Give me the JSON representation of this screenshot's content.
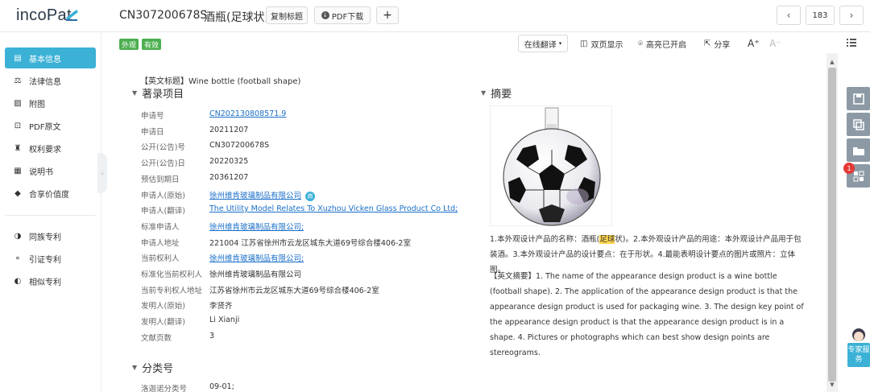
{
  "app": {
    "logo_text": "incoPat",
    "patent_no": "CN307200678S",
    "patent_name": "酒瓶(足球状)",
    "copy_title_label": "复制标题",
    "pdf_download_label": "PDF下载",
    "add_label": "+",
    "page_number": "183"
  },
  "sidebar": {
    "items": [
      {
        "label": "基本信息",
        "icon": "document-icon"
      },
      {
        "label": "法律信息",
        "icon": "scale-icon"
      },
      {
        "label": "附图",
        "icon": "image-icon"
      },
      {
        "label": "PDF原文",
        "icon": "pdf-icon"
      },
      {
        "label": "权利要求",
        "icon": "stamp-icon"
      },
      {
        "label": "说明书",
        "icon": "book-icon"
      },
      {
        "label": "合享价值度",
        "icon": "diamond-icon"
      }
    ],
    "group2": [
      {
        "label": "同族专利",
        "icon": "family-icon"
      },
      {
        "label": "引证专利",
        "icon": "citation-icon"
      },
      {
        "label": "相似专利",
        "icon": "similar-icon"
      }
    ]
  },
  "tags": [
    "外观",
    "有效"
  ],
  "toolbar": {
    "translate": "在线翻译",
    "dual": "双页显示",
    "highlight": "高亮已开启",
    "share": "分享",
    "font_up": "A⁺",
    "font_down": "A⁻"
  },
  "main": {
    "en_title_prefix": "【英文标题】",
    "en_title": "Wine bottle (football shape)",
    "biblio_heading": "著录项目",
    "fields": [
      {
        "label": "申请号",
        "value": "CN202130808571.9",
        "link": true
      },
      {
        "label": "申请日",
        "value": "20211207"
      },
      {
        "label": "公开(公告)号",
        "value": "CN307200678S"
      },
      {
        "label": "公开(公告)日",
        "value": "20220325"
      },
      {
        "label": "预估到期日",
        "value": "20361207"
      },
      {
        "label": "申请人(原始)",
        "value": "徐州维肯玻璃制品有限公司",
        "link": true,
        "badge": "商"
      },
      {
        "label": "申请人(翻译)",
        "value": "The Utility Model Relates To Xuzhou Vicken Glass Product Co Ltd;",
        "link": true
      },
      {
        "label": "标准申请人",
        "value": "徐州维肯玻璃制品有限公司;",
        "link": true
      },
      {
        "label": "申请人地址",
        "value": "221004 江苏省徐州市云龙区城东大道69号综合楼406-2室"
      },
      {
        "label": "当前权利人",
        "value": "徐州维肯玻璃制品有限公司;",
        "link": true
      },
      {
        "label": "标准化当前权利人",
        "value": "徐州维肯玻璃制品有限公司"
      },
      {
        "label": "当前专利权人地址",
        "value": "江苏省徐州市云龙区城东大道69号综合楼406-2室"
      },
      {
        "label": "发明人(原始)",
        "value": "李贤齐"
      },
      {
        "label": "发明人(翻译)",
        "value": "Li Xianji"
      },
      {
        "label": "文献页数",
        "value": "3"
      }
    ],
    "class_heading": "分类号",
    "class_field": {
      "label": "洛迦诺分类号",
      "value": "09-01;"
    },
    "abstract_heading": "摘要",
    "abstract_cn_pre": "1.本外观设计产品的名称：酒瓶(",
    "abstract_cn_hl": "足球",
    "abstract_cn_post": "状)。2.本外观设计产品的用途：本外观设计产品用于包装酒。3.本外观设计产品的设计要点：在于形状。4.最能表明设计要点的图片或照片：立体图。",
    "abstract_en_prefix": "【英文摘要】",
    "abstract_en": "1. The name of the appearance design product is a wine bottle (football shape). 2. The application of the appearance design product is that the appearance design product is used for packaging wine. 3. The design key point of the appearance design product is that the appearance design product is in a shape. 4. Pictures or photographs which can best show design points are stereograms."
  },
  "rail": {
    "badge_count": "1",
    "expert_label": "专家服务"
  },
  "colors": {
    "accent": "#3bb1d6",
    "link": "#1a6fc8",
    "tag_green": "#4caf50",
    "highlight": "#ffd54f"
  }
}
